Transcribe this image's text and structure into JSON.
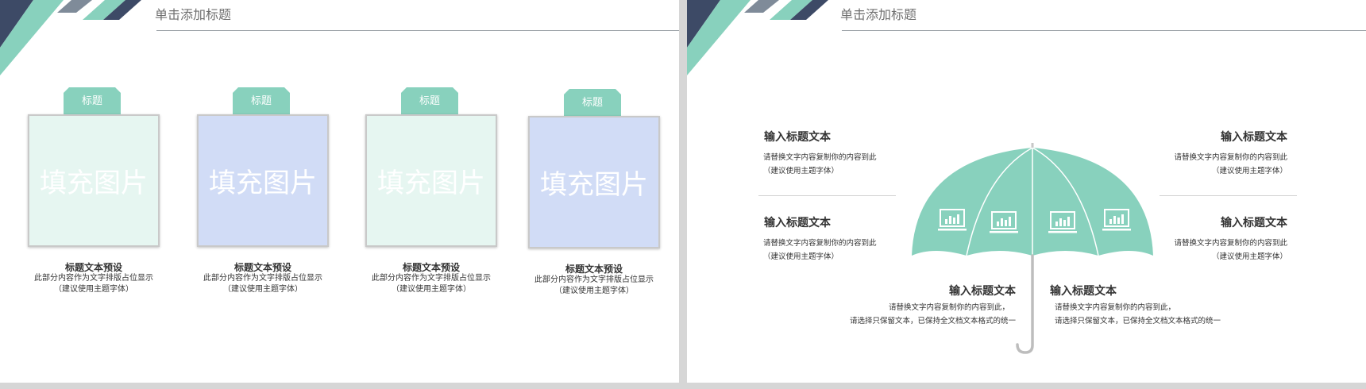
{
  "colors": {
    "mint": "#88d1bd",
    "mint_light": "#e6f6f1",
    "blue_light": "#d1dcf6",
    "navy": "#3d4a66",
    "slate": "#7f8b99"
  },
  "left_slide": {
    "title": "单击添加标题",
    "cards": [
      {
        "tag": "标题",
        "placeholder": "填充图片",
        "title": "标题文本预设",
        "desc1": "此部分内容作为文字排版占位显示",
        "desc2": "（建议使用主题字体）"
      },
      {
        "tag": "标题",
        "placeholder": "填充图片",
        "title": "标题文本预设",
        "desc1": "此部分内容作为文字排版占位显示",
        "desc2": "（建议使用主题字体）"
      },
      {
        "tag": "标题",
        "placeholder": "填充图片",
        "title": "标题文本预设",
        "desc1": "此部分内容作为文字排版占位显示",
        "desc2": "（建议使用主题字体）"
      },
      {
        "tag": "标题",
        "placeholder": "填充图片",
        "title": "标题文本预设",
        "desc1": "此部分内容作为文字排版占位显示",
        "desc2": "（建议使用主题字体）"
      }
    ]
  },
  "right_slide": {
    "title": "单击添加标题",
    "blocks": {
      "top_left": {
        "heading": "输入标题文本",
        "line1": "请替换文字内容复制你的内容到此",
        "line2": "（建议使用主题字体）"
      },
      "mid_left": {
        "heading": "输入标题文本",
        "line1": "请替换文字内容复制你的内容到此",
        "line2": "（建议使用主题字体）"
      },
      "top_right": {
        "heading": "输入标题文本",
        "line1": "请替换文字内容复制你的内容到此",
        "line2": "（建议使用主题字体）"
      },
      "mid_right": {
        "heading": "输入标题文本",
        "line1": "请替换文字内容复制你的内容到此",
        "line2": "（建议使用主题字体）"
      },
      "bottom_left": {
        "heading": "输入标题文本",
        "line1": "请替换文字内容复制你的内容到此，",
        "line2": "请选择只保留文本，已保持全文档文本格式的统一"
      },
      "bottom_right": {
        "heading": "输入标题文本",
        "line1": "请替换文字内容复制你的内容到此，",
        "line2": "请选择只保留文本，已保持全文档文本格式的统一"
      }
    },
    "umbrella_icons": [
      "monitor-chart-icon",
      "monitor-chart-icon",
      "monitor-chart-icon",
      "monitor-chart-icon"
    ]
  }
}
